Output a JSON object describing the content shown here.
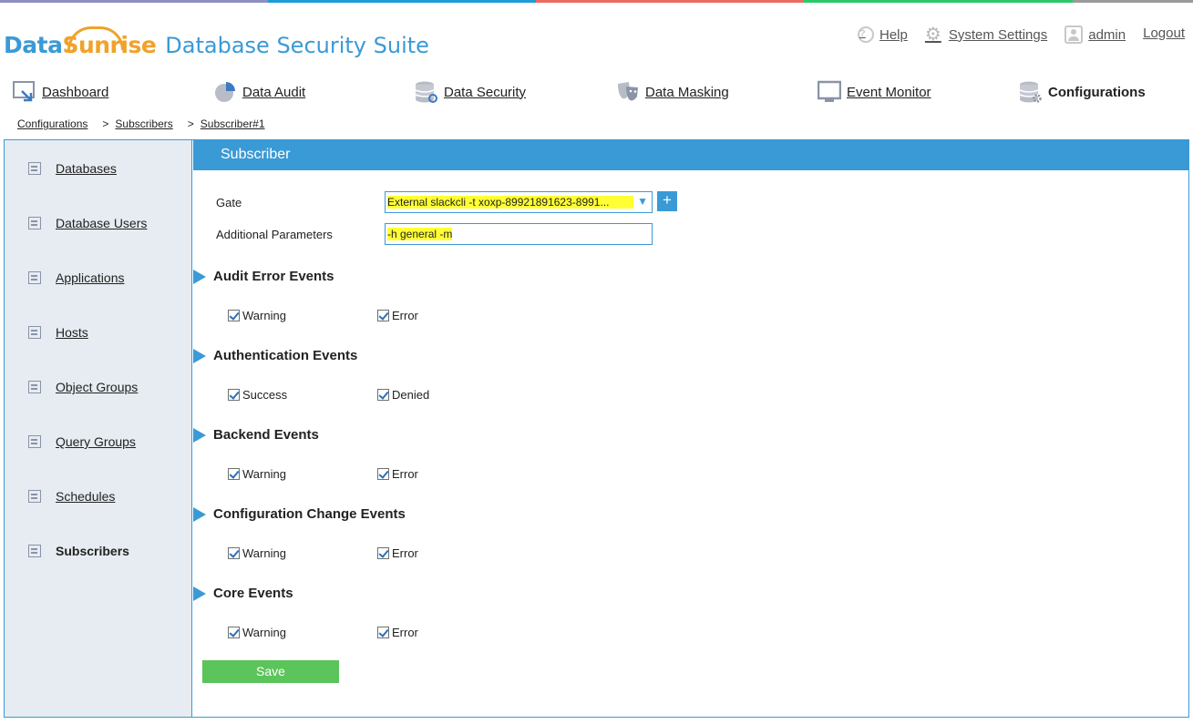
{
  "colors": {
    "accent": "#3a9ad6",
    "brand_orange": "#f0a22a",
    "save_green": "#5bc45a",
    "highlight": "#ffff33",
    "sidebar_bg": "#e6ecf1",
    "stripe": [
      "#8e8fc0",
      "#1e9cd8",
      "#e96c5e",
      "#2cc96a",
      "#9a9a9a"
    ]
  },
  "logo": {
    "data": "Data",
    "sunrise": "Sunrise",
    "suite": "Database Security Suite"
  },
  "toplinks": {
    "help": "Help",
    "system_settings": "System Settings",
    "admin": "admin",
    "logout": "Logout"
  },
  "nav": {
    "dashboard": "Dashboard",
    "data_audit": "Data Audit",
    "data_security": "Data Security",
    "data_masking": "Data Masking",
    "event_monitor": "Event Monitor",
    "configurations": "Configurations"
  },
  "breadcrumb": [
    "Configurations",
    "Subscribers",
    "Subscriber#1"
  ],
  "breadcrumb_sep": ">",
  "sidebar": {
    "items": [
      {
        "label": "Databases"
      },
      {
        "label": "Database Users"
      },
      {
        "label": "Applications"
      },
      {
        "label": "Hosts"
      },
      {
        "label": "Object Groups"
      },
      {
        "label": "Query Groups"
      },
      {
        "label": "Schedules"
      },
      {
        "label": "Subscribers"
      }
    ]
  },
  "content": {
    "header": "Subscriber",
    "gate_label": "Gate",
    "gate_value": "External slackcli -t xoxp-89921891623-8991...",
    "add_symbol": "+",
    "dropdown_symbol": "▼",
    "params_label": "Additional Parameters",
    "params_value": "-h general -m",
    "sections": [
      {
        "title": "Audit Error Events",
        "options": [
          {
            "label": "Warning",
            "checked": true
          },
          {
            "label": "Error",
            "checked": true
          }
        ]
      },
      {
        "title": "Authentication Events",
        "options": [
          {
            "label": "Success",
            "checked": true
          },
          {
            "label": "Denied",
            "checked": true
          }
        ]
      },
      {
        "title": "Backend Events",
        "options": [
          {
            "label": "Warning",
            "checked": true
          },
          {
            "label": "Error",
            "checked": true
          }
        ]
      },
      {
        "title": "Configuration Change Events",
        "options": [
          {
            "label": "Warning",
            "checked": true
          },
          {
            "label": "Error",
            "checked": true
          }
        ]
      },
      {
        "title": "Core Events",
        "options": [
          {
            "label": "Warning",
            "checked": true
          },
          {
            "label": "Error",
            "checked": true
          }
        ]
      }
    ],
    "save_label": "Save"
  }
}
